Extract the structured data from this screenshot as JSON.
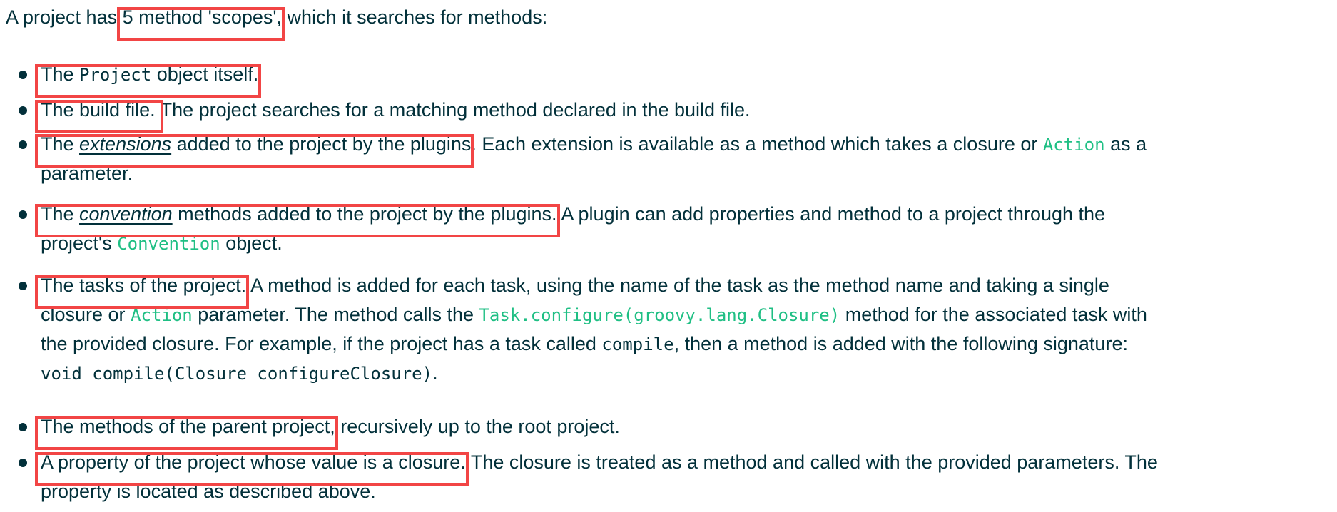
{
  "intro": {
    "before": "A project has ",
    "highlight": "5 method 'scopes',",
    "after": " which it searches for methods:"
  },
  "items": [
    {
      "lines": [
        [
          {
            "t": "The ",
            "k": "hl"
          },
          {
            "t": "Project",
            "k": "code-dark-hl"
          },
          {
            "t": " object itself.",
            "k": "hl"
          }
        ]
      ]
    },
    {
      "lines": [
        [
          {
            "t": "The build file. ",
            "k": "hl"
          },
          {
            "t": "The project searches for a matching method declared in the build file.",
            "k": "text"
          }
        ]
      ]
    },
    {
      "lines": [
        [
          {
            "t": "The ",
            "k": "hl"
          },
          {
            "t": "extensions",
            "k": "em-hl"
          },
          {
            "t": " added to the project by the plugins",
            "k": "hl"
          },
          {
            "t": ". Each extension is available as a method which takes a closure or ",
            "k": "text"
          },
          {
            "t": "Action",
            "k": "code-green"
          },
          {
            "t": " as a",
            "k": "text"
          }
        ],
        [
          {
            "t": "parameter.",
            "k": "text"
          }
        ]
      ]
    },
    {
      "lines": [
        [
          {
            "t": "The ",
            "k": "hl"
          },
          {
            "t": "convention",
            "k": "em-hl"
          },
          {
            "t": " methods added to the project by the plugins.",
            "k": "hl"
          },
          {
            "t": " A plugin can add properties and method to a project through the",
            "k": "text"
          }
        ],
        [
          {
            "t": "project's ",
            "k": "text"
          },
          {
            "t": "Convention",
            "k": "code-green"
          },
          {
            "t": " object.",
            "k": "text"
          }
        ]
      ]
    },
    {
      "lines": [
        [
          {
            "t": "The tasks of the project.",
            "k": "hl"
          },
          {
            "t": " A method is added for each task, using the name of the task as the method name and taking a single",
            "k": "text"
          }
        ],
        [
          {
            "t": "closure or ",
            "k": "text"
          },
          {
            "t": "Action",
            "k": "code-green"
          },
          {
            "t": " parameter. The method calls the ",
            "k": "text"
          },
          {
            "t": "Task.configure(groovy.lang.Closure)",
            "k": "code-green"
          },
          {
            "t": " method for the associated task with",
            "k": "text"
          }
        ],
        [
          {
            "t": "the provided closure. For example, if the project has a task called ",
            "k": "text"
          },
          {
            "t": "compile",
            "k": "code-dark"
          },
          {
            "t": ", then a method is added with the following signature:",
            "k": "text"
          }
        ],
        [
          {
            "t": "void compile(Closure configureClosure)",
            "k": "code-dark"
          },
          {
            "t": ".",
            "k": "text"
          }
        ]
      ]
    },
    {
      "lines": [
        [
          {
            "t": "The methods of the parent project,",
            "k": "hl"
          },
          {
            "t": " recursively up to the root project.",
            "k": "text"
          }
        ]
      ]
    },
    {
      "lines": [
        [
          {
            "t": "A property of the project whose value is a closure.",
            "k": "hl"
          },
          {
            "t": " The closure is treated as a method and called with the provided parameters. The",
            "k": "text"
          }
        ],
        [
          {
            "t": "property is located as described above.",
            "k": "text"
          }
        ]
      ]
    }
  ],
  "highlight_color": "#f24545",
  "text_color": "#02303a",
  "code_color": "#1fbf84"
}
